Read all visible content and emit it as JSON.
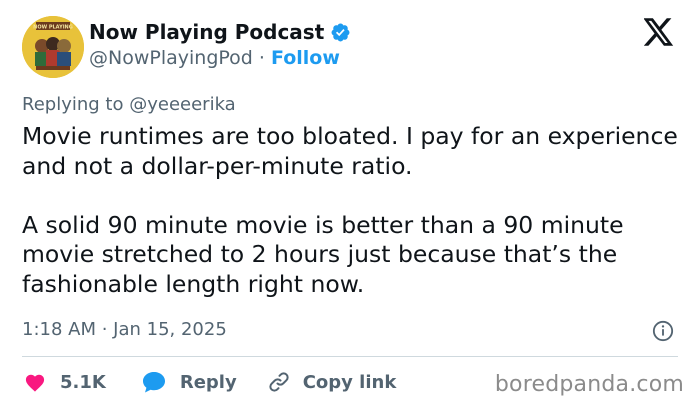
{
  "author": {
    "display_name": "Now Playing Podcast",
    "handle": "@NowPlayingPod",
    "separator": "·",
    "follow_label": "Follow",
    "avatar_text": "NOW PLAYING"
  },
  "reply_context": {
    "prefix": "Replying to",
    "mention": "@yeeeerika"
  },
  "tweet": {
    "text": "Movie runtimes are too bloated. I pay for an experience and not a dollar-per-minute ratio.\n\nA solid 90 minute movie is better than a 90 minute movie stretched to 2 hours just because that’s the fashionable length right now.",
    "timestamp": "1:18 AM · Jan 15, 2025"
  },
  "actions": {
    "like_count": "5.1K",
    "reply_label": "Reply",
    "copy_link_label": "Copy link"
  },
  "watermark": "boredpanda.com",
  "colors": {
    "accent": "#1d9bf0",
    "like": "#f91880",
    "text": "#0f1419",
    "muted": "#536471",
    "avatar_bg": "#e8c23a"
  },
  "icons": [
    "verified-badge-icon",
    "x-logo-icon",
    "info-icon",
    "heart-icon",
    "reply-bubble-icon",
    "link-icon"
  ]
}
